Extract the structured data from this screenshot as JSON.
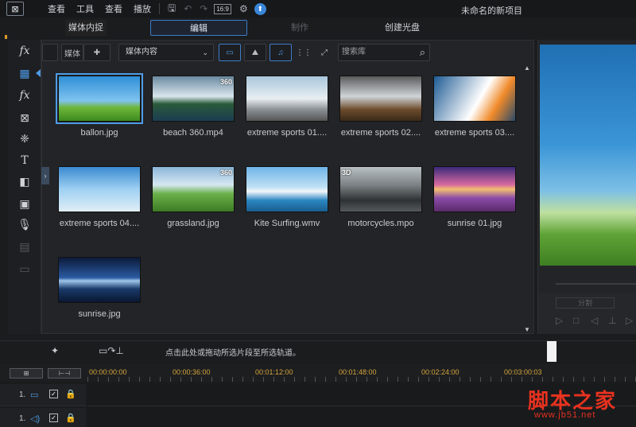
{
  "menubar": {
    "items": [
      "查看",
      "播放"
    ],
    "partial_items": [
      "查看",
      "工具"
    ],
    "aspect_ratio": "16:9",
    "project_title": "未命名的新项目"
  },
  "modes": {
    "capture": "媒体内捉",
    "edit": "编辑",
    "produce": "制作",
    "create_disc": "创建光盘"
  },
  "library": {
    "filter_left": "媒体",
    "content_select": "媒体内容",
    "search_placeholder": "搜索库",
    "items": [
      {
        "label": "ballon.jpg",
        "badge": "",
        "selected": true
      },
      {
        "label": "beach 360.mp4",
        "badge": "360"
      },
      {
        "label": "extreme sports 01....",
        "badge": ""
      },
      {
        "label": "extreme sports 02....",
        "badge": ""
      },
      {
        "label": "extreme sports 03....",
        "badge": ""
      },
      {
        "label": "extreme sports 04....",
        "badge": ""
      },
      {
        "label": "grassland.jpg",
        "badge": "360"
      },
      {
        "label": "Kite Surfing.wmv",
        "badge": ""
      },
      {
        "label": "motorcycles.mpo",
        "badge": "3D"
      },
      {
        "label": "sunrise 01.jpg",
        "badge": ""
      },
      {
        "label": "sunrise.jpg",
        "badge": ""
      }
    ]
  },
  "preview": {
    "split_label": "分割"
  },
  "timeline": {
    "hint": "点击此处或拖动所选片段至所选轨道。",
    "timecodes": [
      "00:00:00:00",
      "00:00:36:00",
      "00:01:12:00",
      "00:01:48:00",
      "00:02:24:00",
      "00:03:00:03"
    ],
    "tracks": [
      {
        "number": "1."
      },
      {
        "number": "1."
      }
    ]
  },
  "watermark": {
    "text": "脚本之家",
    "url": "www.jb51.net"
  },
  "colors": {
    "accent": "#4d9be6",
    "timecode": "#d4a53c",
    "watermark": "#e8321f"
  }
}
